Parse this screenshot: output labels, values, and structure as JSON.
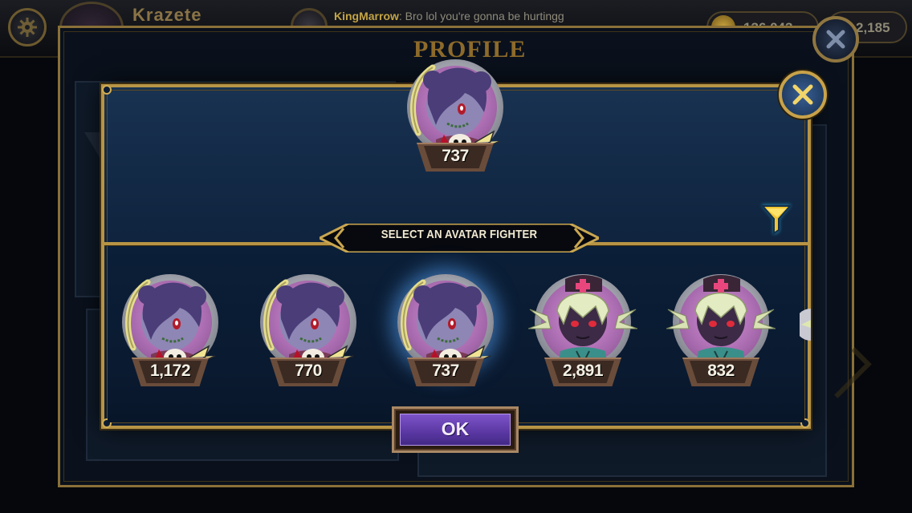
{
  "topbar": {
    "player_name": "Krazete",
    "chat_sender": "KingMarrow",
    "chat_message": ": Bro lol you're gonna be hurtingg",
    "coins": "136,043",
    "gems": "2,185"
  },
  "profile": {
    "title": "PROFILE"
  },
  "modal": {
    "banner": "SELECT AN AVATAR FIGHTER",
    "ok_label": "OK",
    "current_avatar": {
      "character": "squigly",
      "value": "737"
    },
    "avatars": [
      {
        "character": "squigly",
        "value": "1,172",
        "selected": false
      },
      {
        "character": "squigly",
        "value": "770",
        "selected": false
      },
      {
        "character": "squigly",
        "value": "737",
        "selected": true
      },
      {
        "character": "valentine",
        "value": "2,891",
        "selected": false
      },
      {
        "character": "valentine",
        "value": "832",
        "selected": false
      }
    ]
  },
  "icons": {
    "settings": "gear-icon",
    "close": "close-icon",
    "filter": "filter-icon"
  },
  "colors": {
    "gold_border": "#b79445",
    "modal_bg": "#102540",
    "ok_button": "#5a37a2",
    "filter": "#2ec4f0",
    "avatar_disc": "#a86aae"
  }
}
